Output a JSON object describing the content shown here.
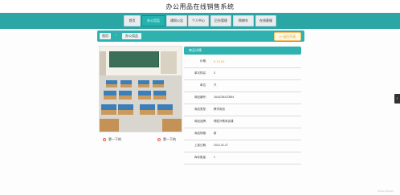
{
  "header": {
    "title": "办公用品在线销售系统"
  },
  "nav": {
    "items": [
      {
        "label": "首页",
        "active": false
      },
      {
        "label": "办公用品",
        "active": true
      },
      {
        "label": "通知公告",
        "active": false
      },
      {
        "label": "个人中心",
        "active": false
      },
      {
        "label": "后台管理",
        "active": false
      },
      {
        "label": "购物车",
        "active": false
      },
      {
        "label": "在线客服",
        "active": false
      }
    ]
  },
  "breadcrumb": {
    "home": "首页",
    "separator": "/",
    "current": "办公用品"
  },
  "actions": {
    "return_label": "↩ 返回列表"
  },
  "detail": {
    "header": "商品详情",
    "rows": [
      {
        "label": "价格:",
        "value": "¥ 13.00"
      },
      {
        "label": "单次购买:",
        "value": "3"
      },
      {
        "label": "单位:",
        "value": "只"
      },
      {
        "label": "商品编号:",
        "value": "1644784470894"
      },
      {
        "label": "商品类型:",
        "value": "教学用品"
      },
      {
        "label": "商品品牌:",
        "value": "得胜外教商谈课"
      },
      {
        "label": "商品规格:",
        "value": "新"
      },
      {
        "label": "上架日期:",
        "value": "2022-02-07"
      },
      {
        "label": "库存数量:",
        "value": "1"
      }
    ]
  },
  "pager": {
    "prev": "第一下的",
    "next": "第一下的"
  },
  "footer": {
    "note": "Online Support"
  },
  "colors": {
    "accent": "#2eb1af",
    "price": "#e6a23c"
  }
}
